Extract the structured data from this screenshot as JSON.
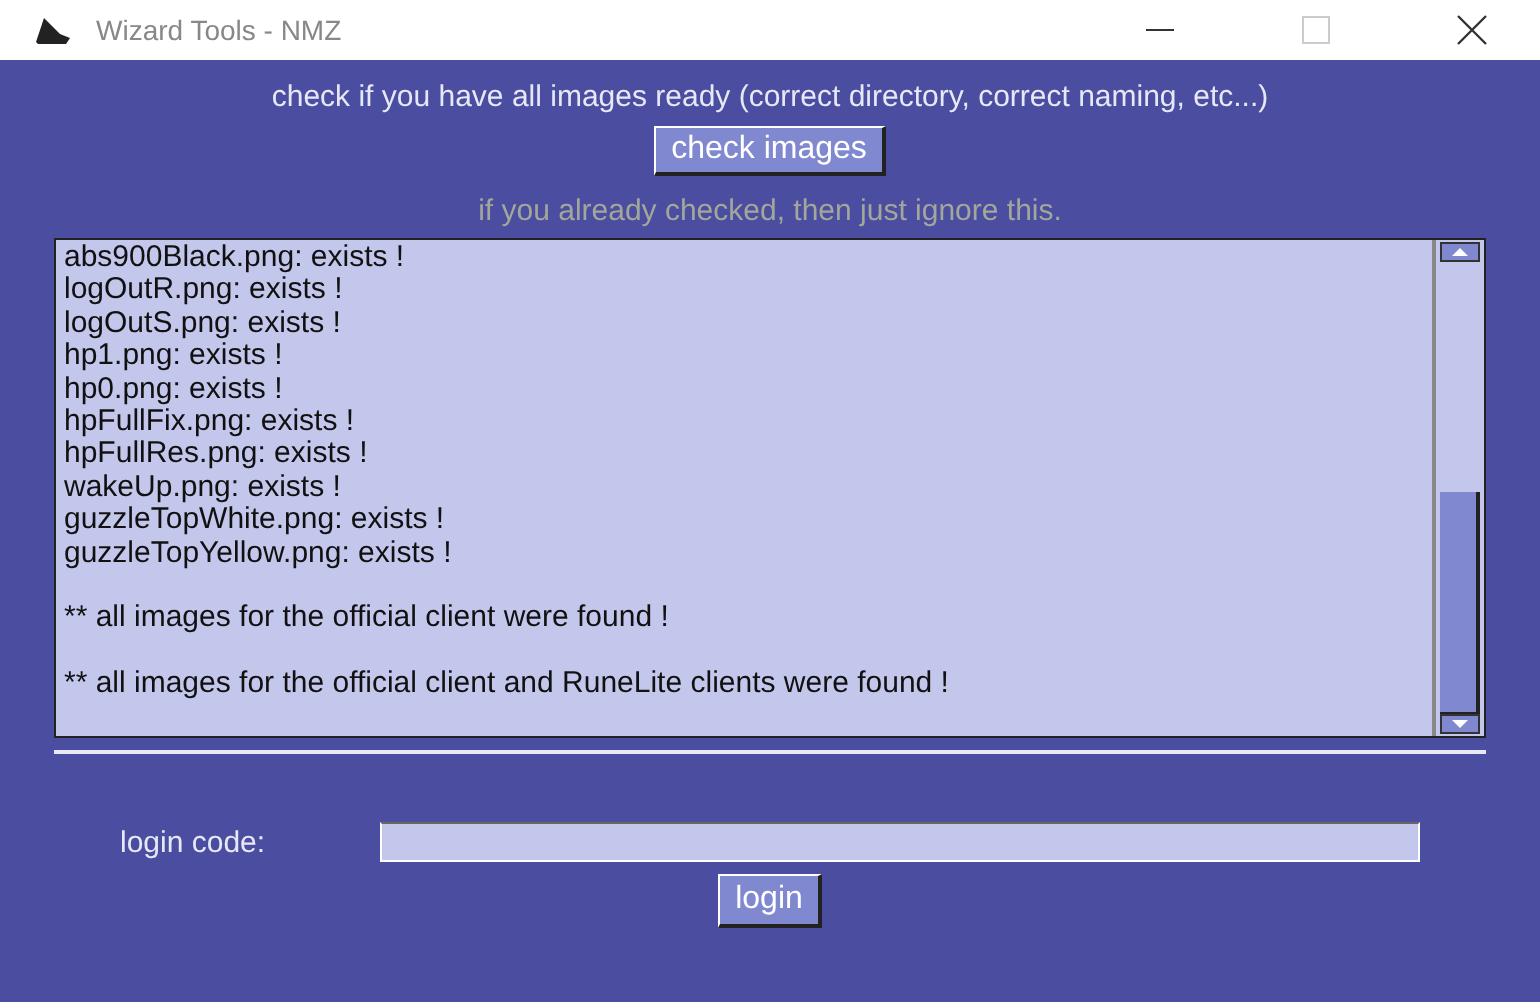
{
  "window": {
    "title": "Wizard Tools - NMZ"
  },
  "instruction": "check if you have all images ready (correct directory, correct naming, etc...)",
  "check_button": "check images",
  "hint": "if you already checked, then just ignore this.",
  "log": [
    {
      "kind": "file",
      "text": "abs900Black.png: exists !"
    },
    {
      "kind": "file",
      "text": "logOutR.png: exists !"
    },
    {
      "kind": "file",
      "text": "logOutS.png: exists !"
    },
    {
      "kind": "file",
      "text": "hp1.png: exists !"
    },
    {
      "kind": "file",
      "text": "hp0.png: exists !"
    },
    {
      "kind": "file",
      "text": "hpFullFix.png: exists !"
    },
    {
      "kind": "file",
      "text": "hpFullRes.png: exists !"
    },
    {
      "kind": "file",
      "text": "wakeUp.png: exists !"
    },
    {
      "kind": "file",
      "text": "guzzleTopWhite.png: exists !"
    },
    {
      "kind": "file",
      "text": "guzzleTopYellow.png: exists !"
    },
    {
      "kind": "summary",
      "text": "** all images for the official client were found !"
    },
    {
      "kind": "summary",
      "text": "** all images for the official client and RuneLite clients were found !"
    }
  ],
  "login": {
    "label": "login code:",
    "button": "login"
  }
}
